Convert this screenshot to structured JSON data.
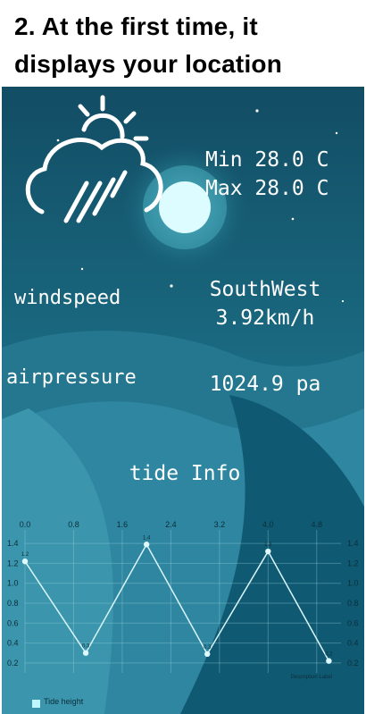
{
  "caption": {
    "line1": "2. At the first time, it",
    "line2": "displays your location"
  },
  "weather": {
    "icon": "cloud-rain-sun-icon",
    "min": "Min 28.0 C",
    "max": "Max 28.0 C"
  },
  "wind": {
    "label": "windspeed",
    "direction": "SouthWest",
    "speed": "3.92km/h"
  },
  "pressure": {
    "label": "airpressure",
    "value": "1024.9 pa"
  },
  "tide": {
    "title": "tide Info"
  },
  "colors": {
    "sky": "#15576d",
    "dune_light": "#3a8aa1",
    "dune_dark": "#0f4d63",
    "moon": "#d8fbff",
    "line": "#d9f6fb"
  },
  "chart_data": {
    "type": "line",
    "x_ticks": [
      "0.0",
      "0.8",
      "1.6",
      "2.4",
      "3.2",
      "4.0",
      "4.8"
    ],
    "y_ticks": [
      "0.2",
      "0.4",
      "0.6",
      "0.8",
      "1.0",
      "1.2",
      "1.4"
    ],
    "xlim": [
      0,
      5.2
    ],
    "ylim": [
      0.1,
      1.5
    ],
    "series": [
      {
        "name": "Tide height",
        "x": [
          0,
          1,
          2,
          3,
          4,
          5
        ],
        "values": [
          1.22,
          0.3,
          1.39,
          0.29,
          1.32,
          0.22
        ],
        "point_labels": [
          "1.2",
          "0.3",
          "1.4",
          "0.3",
          "1.3",
          "0.2"
        ]
      }
    ],
    "legend": "bottom-left",
    "grid": true,
    "description": "Description Label"
  }
}
